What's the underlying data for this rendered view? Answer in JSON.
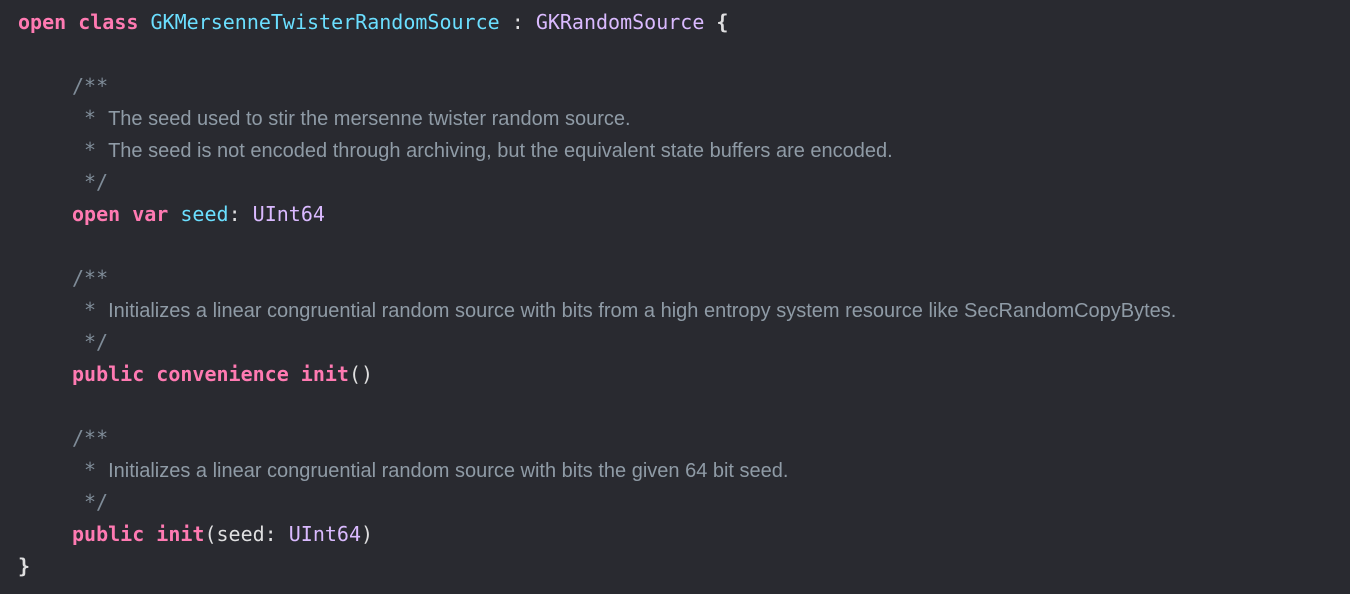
{
  "code": {
    "class_line": {
      "kw_open": "open",
      "kw_class": "class",
      "class_name": "GKMersenneTwisterRandomSource",
      "colon": " : ",
      "superclass": "GKRandomSource",
      "brace": " {"
    },
    "doc1": {
      "open": "/**",
      "star": "*",
      "line1": "The seed used to stir the mersenne twister random source.",
      "line2": "The seed is not encoded through archiving, but the equivalent state buffers are encoded.",
      "close": "*/"
    },
    "seed_decl": {
      "kw_open": "open",
      "kw_var": "var",
      "name": "seed",
      "colon": ": ",
      "type": "UInt64"
    },
    "doc2": {
      "open": "/**",
      "star": "*",
      "line1": "Initializes a linear congruential random source with bits from a high entropy system resource like SecRandomCopyBytes.",
      "close": "*/"
    },
    "init1": {
      "kw_public": "public",
      "kw_convenience": "convenience",
      "kw_init": "init",
      "parens": "()"
    },
    "doc3": {
      "open": "/**",
      "star": "*",
      "line1": "Initializes a linear congruential random source with bits the given 64 bit seed.",
      "close": "*/"
    },
    "init2": {
      "kw_public": "public",
      "kw_init": "init",
      "param_open": "(seed: ",
      "type": "UInt64",
      "param_close": ")"
    },
    "closing_brace": "}"
  },
  "colors": {
    "background": "#292a30",
    "keyword": "#ff7ab2",
    "type_declaration": "#6bdfff",
    "type_reference": "#dabaff",
    "plain_text": "#dfdfe0",
    "comment": "#8f9ba6"
  }
}
